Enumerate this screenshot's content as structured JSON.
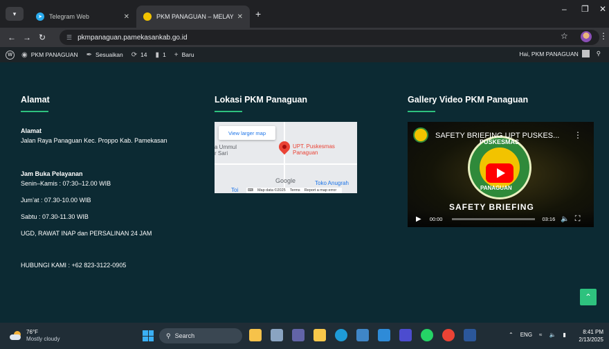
{
  "browser": {
    "tabs": [
      {
        "title": "Telegram Web",
        "active": false,
        "favicon": "telegram-icon",
        "color": "#2aabee"
      },
      {
        "title": "PKM PANAGUAN – MELAYANI D",
        "active": true,
        "favicon": "pkm-logo-icon",
        "color": "#f2c300"
      }
    ],
    "new_tab_label": "+",
    "url": "pkmpanaguan.pamekasankab.go.id"
  },
  "wp_admin_bar": {
    "site_name": "PKM PANAGUAN",
    "customize": "Sesuaikan",
    "updates_count": "14",
    "comments_count": "1",
    "new_label": "Baru",
    "greeting": "Hai, PKM PANAGUAN"
  },
  "footer": {
    "address_section": {
      "heading": "Alamat",
      "address_title": "Alamat",
      "address": "Jalan Raya Panaguan Kec. Proppo Kab. Pamekasan",
      "hours_title": "Jam Buka Pelayanan",
      "hours_weekday": "Senin–Kamis : 07:30–12.00 WIB",
      "hours_friday": "Jum’at : 07.30-10.00 WIB",
      "hours_saturday": "Sabtu : 07.30-11.30 WIB",
      "emergency": "UGD, RAWAT INAP dan PERSALINAN 24 JAM",
      "contact": "HUBUNGI KAMI : +62 823-3122-0905"
    },
    "map_section": {
      "heading": "Lokasi PKM Panaguan",
      "view_larger": "View larger map",
      "place_name": "UPT. Puskesmas Panaguan",
      "area_name": "a Ummul r Sari",
      "google": "Google",
      "nearby": "Toko Anugrah",
      "nearby_left": "Toi",
      "map_data": "Map data ©2025",
      "terms": "Terms",
      "report": "Report a map error"
    },
    "video_section": {
      "heading": "Gallery Video PKM Panaguan",
      "video_title": "SAFETY BRIEFING UPT PUSKES...",
      "badge_top": "PUSKESMAS",
      "badge_bottom": "PANAGUAN",
      "overlay_text": "SAFETY BRIEFING",
      "time_current": "00:00",
      "time_total": "03:16"
    }
  },
  "taskbar": {
    "temperature": "76°F",
    "condition": "Mostly cloudy",
    "search_label": "Search",
    "language": "ENG",
    "time": "8:41 PM",
    "date": "2/13/2025"
  },
  "colors": {
    "accent": "#2ec27e",
    "page_bg": "#0c2a33"
  }
}
